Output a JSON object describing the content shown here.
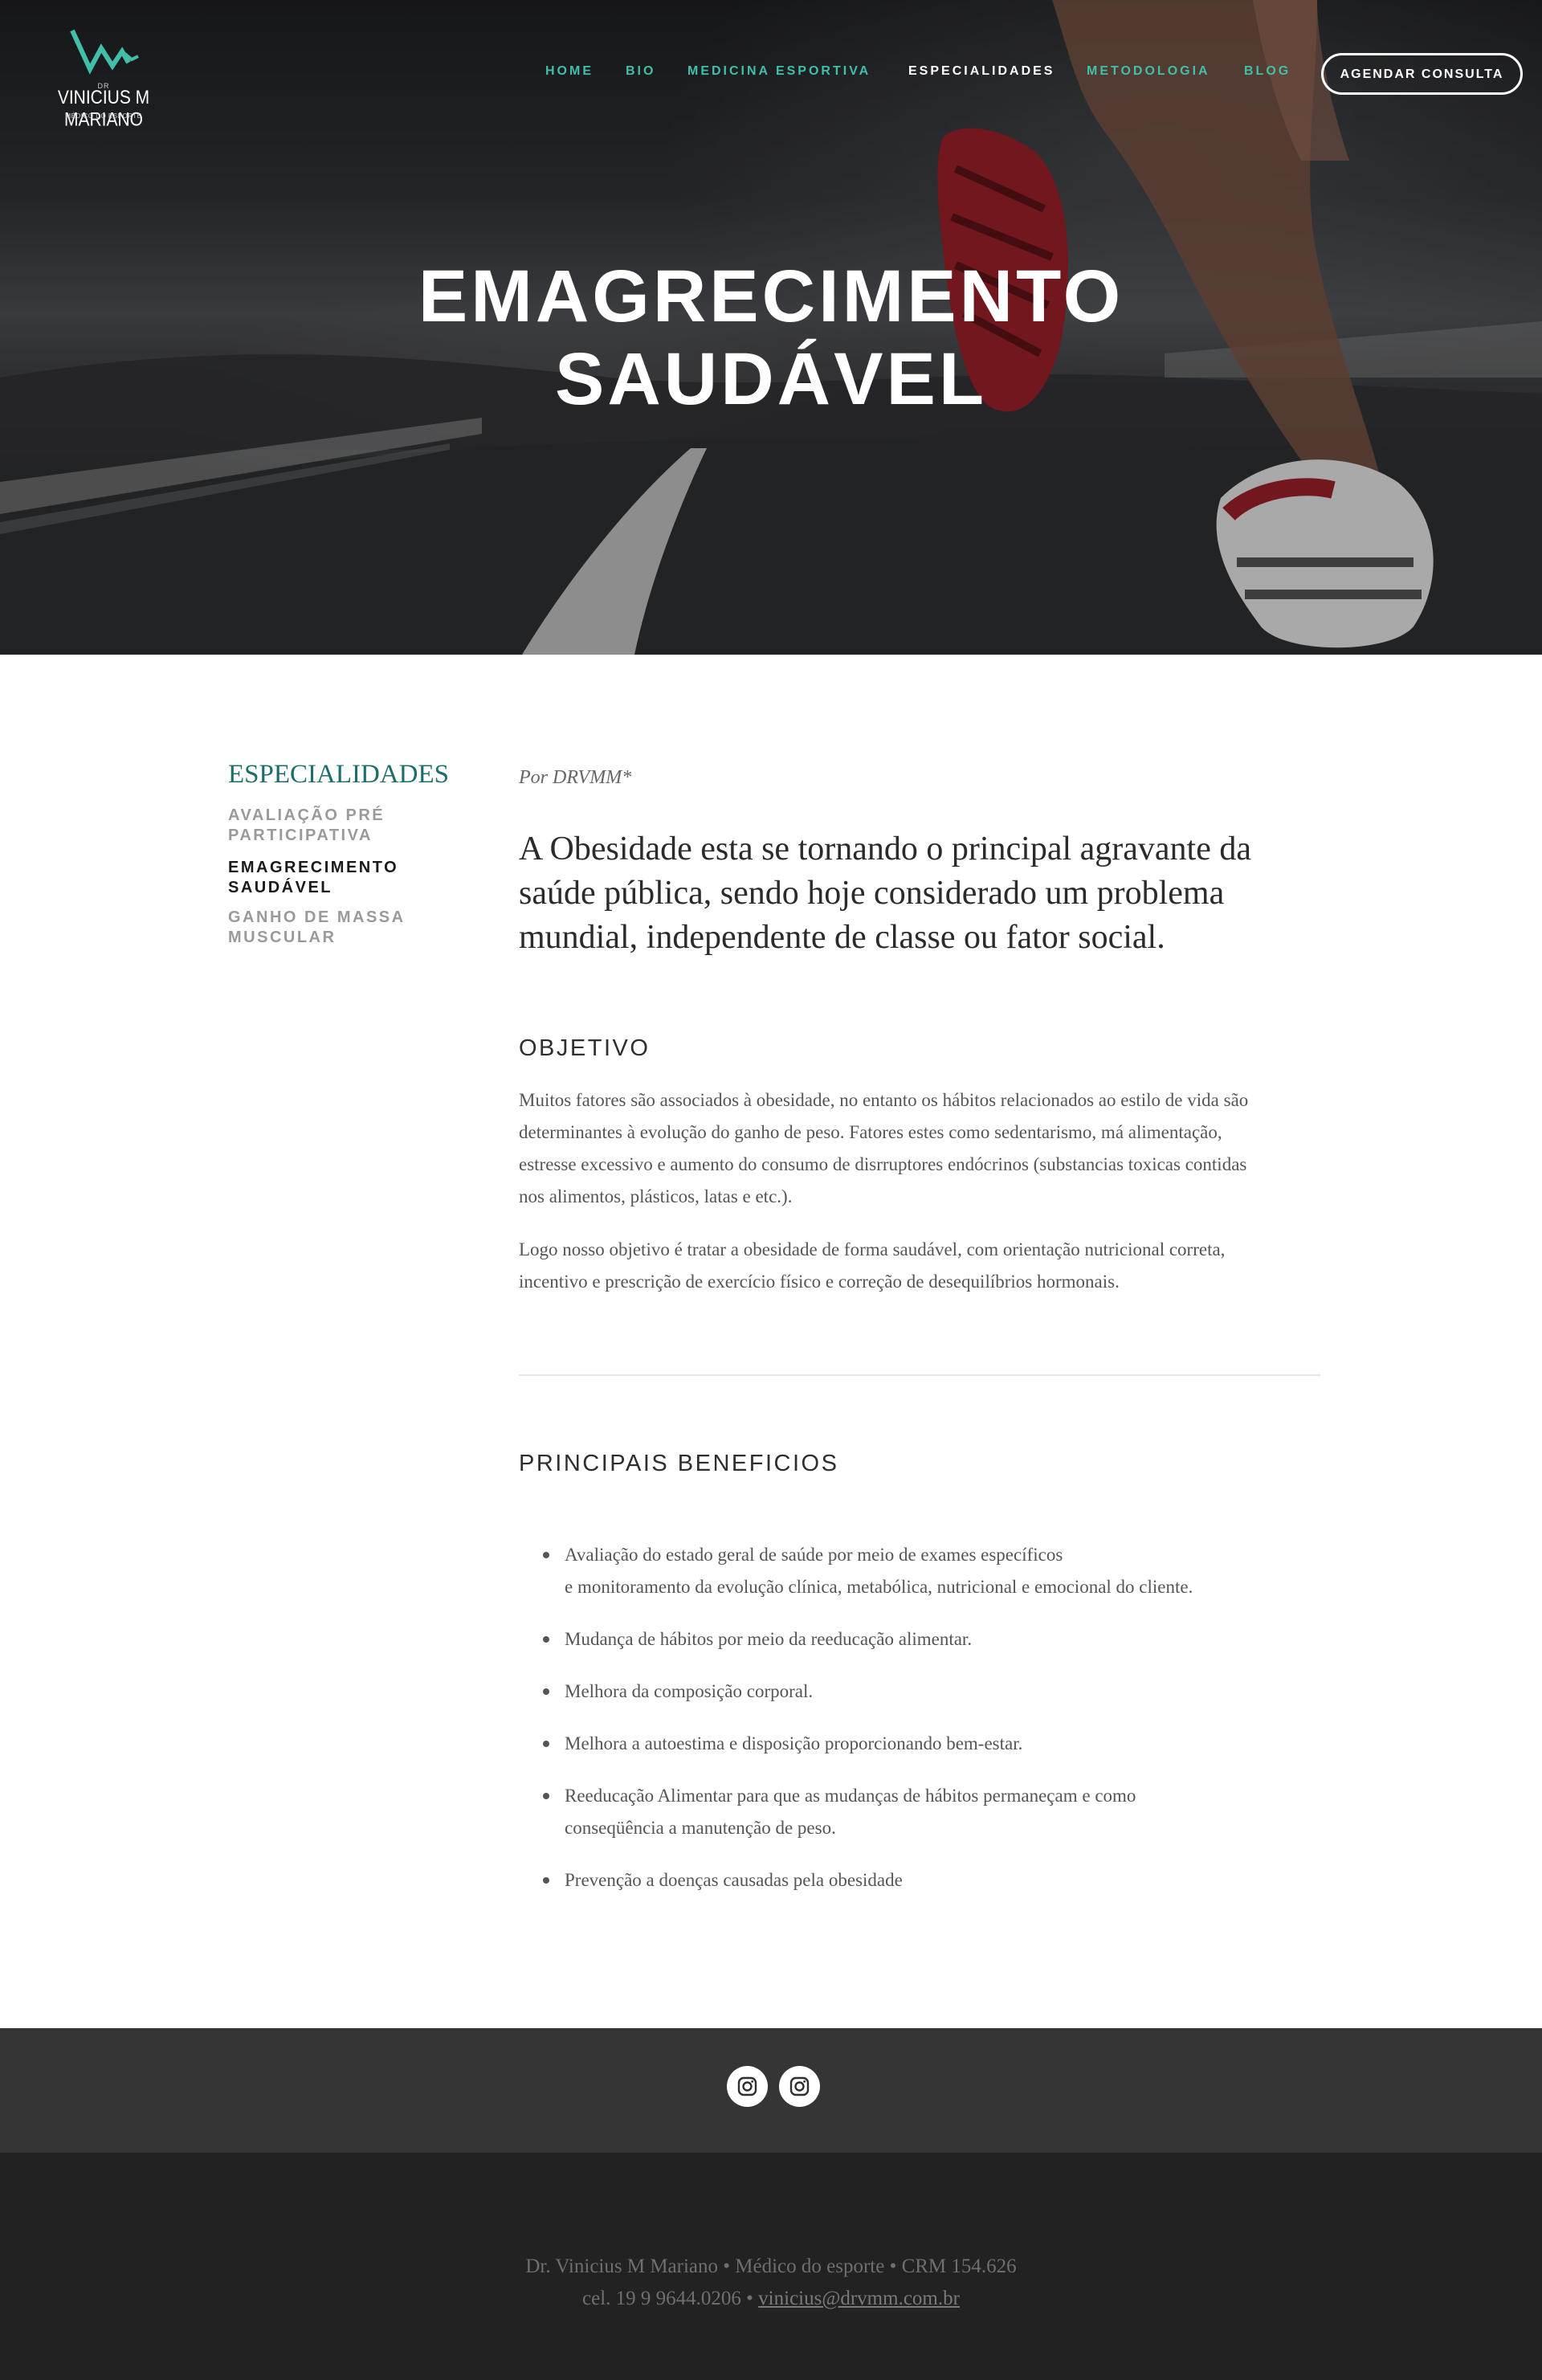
{
  "brand": {
    "logo_small": "DR",
    "logo_name": "VINICIUS M MARIANO",
    "logo_sub": "MÉDICO DO ESPORTE"
  },
  "nav": {
    "items": [
      "HOME",
      "BIO",
      "MEDICINA ESPORTIVA",
      "ESPECIALIDADES",
      "METODOLOGIA",
      "BLOG"
    ],
    "active": "ESPECIALIDADES",
    "cta": "AGENDAR CONSULTA"
  },
  "hero": {
    "title_line1": "EMAGRECIMENTO",
    "title_line2": "SAUDÁVEL"
  },
  "sidebar": {
    "title": "ESPECIALIDADES",
    "items": [
      {
        "line1": "AVALIAÇÃO PRÉ",
        "line2": "PARTICIPATIVA"
      },
      {
        "line1": "EMAGRECIMENTO",
        "line2": "SAUDÁVEL"
      },
      {
        "line1": "GANHO DE MASSA",
        "line2": "MUSCULAR"
      }
    ],
    "active_index": 1
  },
  "article": {
    "byline": "Por DRVMM*",
    "lead_lines": [
      "A Obesidade esta se tornando o principal agravante da",
      "saúde pública, sendo hoje considerado um problema",
      "mundial, independente de classe ou fator social."
    ],
    "objective_heading": "OBJETIVO",
    "objective_p1_lines": [
      "Muitos fatores são associados à obesidade, no entanto os hábitos relacionados ao estilo de vida são",
      "determinantes à evolução do ganho de peso. Fatores estes como sedentarismo, má alimentação,",
      "estresse excessivo e aumento do consumo de disrruptores endócrinos (substancias toxicas contidas",
      "nos alimentos, plásticos, latas e etc.)."
    ],
    "objective_p2_lines": [
      "Logo nosso objetivo é tratar a obesidade de forma saudável, com orientação nutricional correta,",
      "incentivo e prescrição de exercício físico e correção de desequilíbrios hormonais."
    ],
    "benefits_heading": "PRINCIPAIS BENEFICIOS",
    "benefits": [
      {
        "line1": "Avaliação do estado geral de saúde por meio de exames específicos",
        "line2": "e monitoramento da evolução clínica, metabólica, nutricional e emocional do cliente."
      },
      {
        "line1": "Mudança de hábitos por meio da reeducação alimentar."
      },
      {
        "line1": "Melhora da composição corporal."
      },
      {
        "line1": "Melhora a autoestima e disposição proporcionando bem-estar."
      },
      {
        "line1": "Reeducação Alimentar para que as mudanças de hábitos permaneçam e como",
        "line2": "conseqüência a manutenção de peso."
      },
      {
        "line1": "Prevenção a doenças causadas pela obesidade"
      }
    ]
  },
  "social": {
    "icons": [
      "instagram-icon",
      "instagram-icon"
    ]
  },
  "footer": {
    "line1": "Dr. Vinicius M Mariano • Médico do esporte • CRM 154.626",
    "line2_prefix": "cel. 19 9 9644.0206 • ",
    "email": "vinicius@drvmm.com.br"
  },
  "colors": {
    "accent": "#41bfa9",
    "sidebar_title": "#1d6e6a",
    "social_bar": "#353535",
    "footer_bg": "#222222"
  }
}
